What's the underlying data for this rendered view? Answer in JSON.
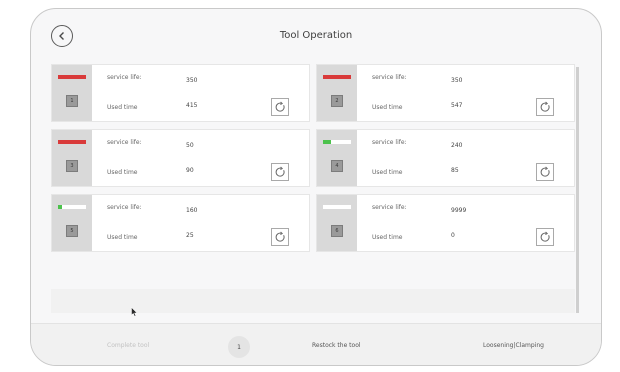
{
  "header": {
    "title": "Tool Operation"
  },
  "cards": [
    {
      "number": "1",
      "service_label": "service life:",
      "service_value": "350",
      "used_label": "Used time",
      "used_value": "415",
      "level": 1.0,
      "level_color": "#d93a3a"
    },
    {
      "number": "2",
      "service_label": "service life:",
      "service_value": "350",
      "used_label": "Used time",
      "used_value": "547",
      "level": 1.0,
      "level_color": "#d93a3a"
    },
    {
      "number": "3",
      "service_label": "service life:",
      "service_value": "50",
      "used_label": "Used time",
      "used_value": "90",
      "level": 1.0,
      "level_color": "#d93a3a"
    },
    {
      "number": "4",
      "service_label": "service life:",
      "service_value": "240",
      "used_label": "Used time",
      "used_value": "85",
      "level": 0.3,
      "level_color": "#4cc24c"
    },
    {
      "number": "5",
      "service_label": "service life:",
      "service_value": "160",
      "used_label": "Used time",
      "used_value": "25",
      "level": 0.15,
      "level_color": "#4cc24c"
    },
    {
      "number": "6",
      "service_label": "service life:",
      "service_value": "9999",
      "used_label": "Used time",
      "used_value": "0",
      "level": 0.0,
      "level_color": "#4cc24c"
    }
  ],
  "footer": {
    "complete_label": "Complete tool",
    "page_number": "1",
    "restock_label": "Restock the tool",
    "loosening_label": "Loosening|Clamping"
  }
}
